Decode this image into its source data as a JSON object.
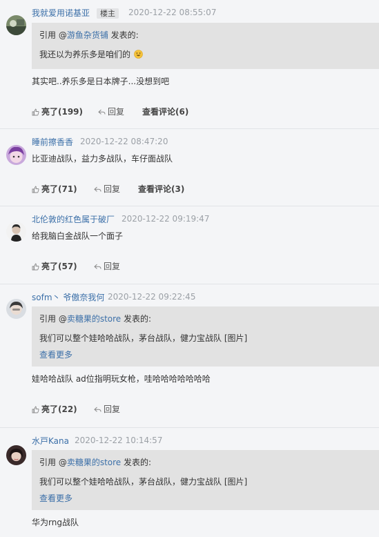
{
  "comments": [
    {
      "user": "我就爱用诺基亚",
      "tag": "楼主",
      "time": "2020-12-22 08:55:07",
      "quote": {
        "prefix": "引用 @",
        "user": "游鱼杂货铺",
        "suffix": " 发表的:",
        "text": "我还以为养乐多是咱们的"
      },
      "text": "其实吧..养乐多是日本牌子...没想到吧",
      "likes": "亮了(199)",
      "reply": "回复",
      "view": "查看评论(6)"
    },
    {
      "user": "睡前擦香香",
      "time": "2020-12-22 08:47:20",
      "text": "比亚迪战队，益力多战队，车仔面战队",
      "likes": "亮了(71)",
      "reply": "回复",
      "view": "查看评论(3)"
    },
    {
      "user": "北伦敦的红色属于破厂",
      "time": "2020-12-22 09:19:47",
      "text": "给我脑白金战队一个面子",
      "likes": "亮了(57)",
      "reply": "回复"
    },
    {
      "user": "sofm丶 爷傲奈我何",
      "time": "2020-12-22 09:22:45",
      "quote": {
        "prefix": "引用 @",
        "user": "卖糖果的store",
        "suffix": " 发表的:",
        "text": "我们可以整个娃哈哈战队，茅台战队，健力宝战队 [图片]",
        "more": "查看更多"
      },
      "text": "娃哈哈战队 ad位指明玩女枪，哇哈哈哈哈哈哈哈",
      "likes": "亮了(22)",
      "reply": "回复"
    },
    {
      "user": "水戸Kana",
      "time": "2020-12-22 10:14:57",
      "quote": {
        "prefix": "引用 @",
        "user": "卖糖果的store",
        "suffix": " 发表的:",
        "text": "我们可以整个娃哈哈战队，茅台战队，健力宝战队 [图片]",
        "more": "查看更多"
      },
      "text": "华为rng战队"
    }
  ]
}
